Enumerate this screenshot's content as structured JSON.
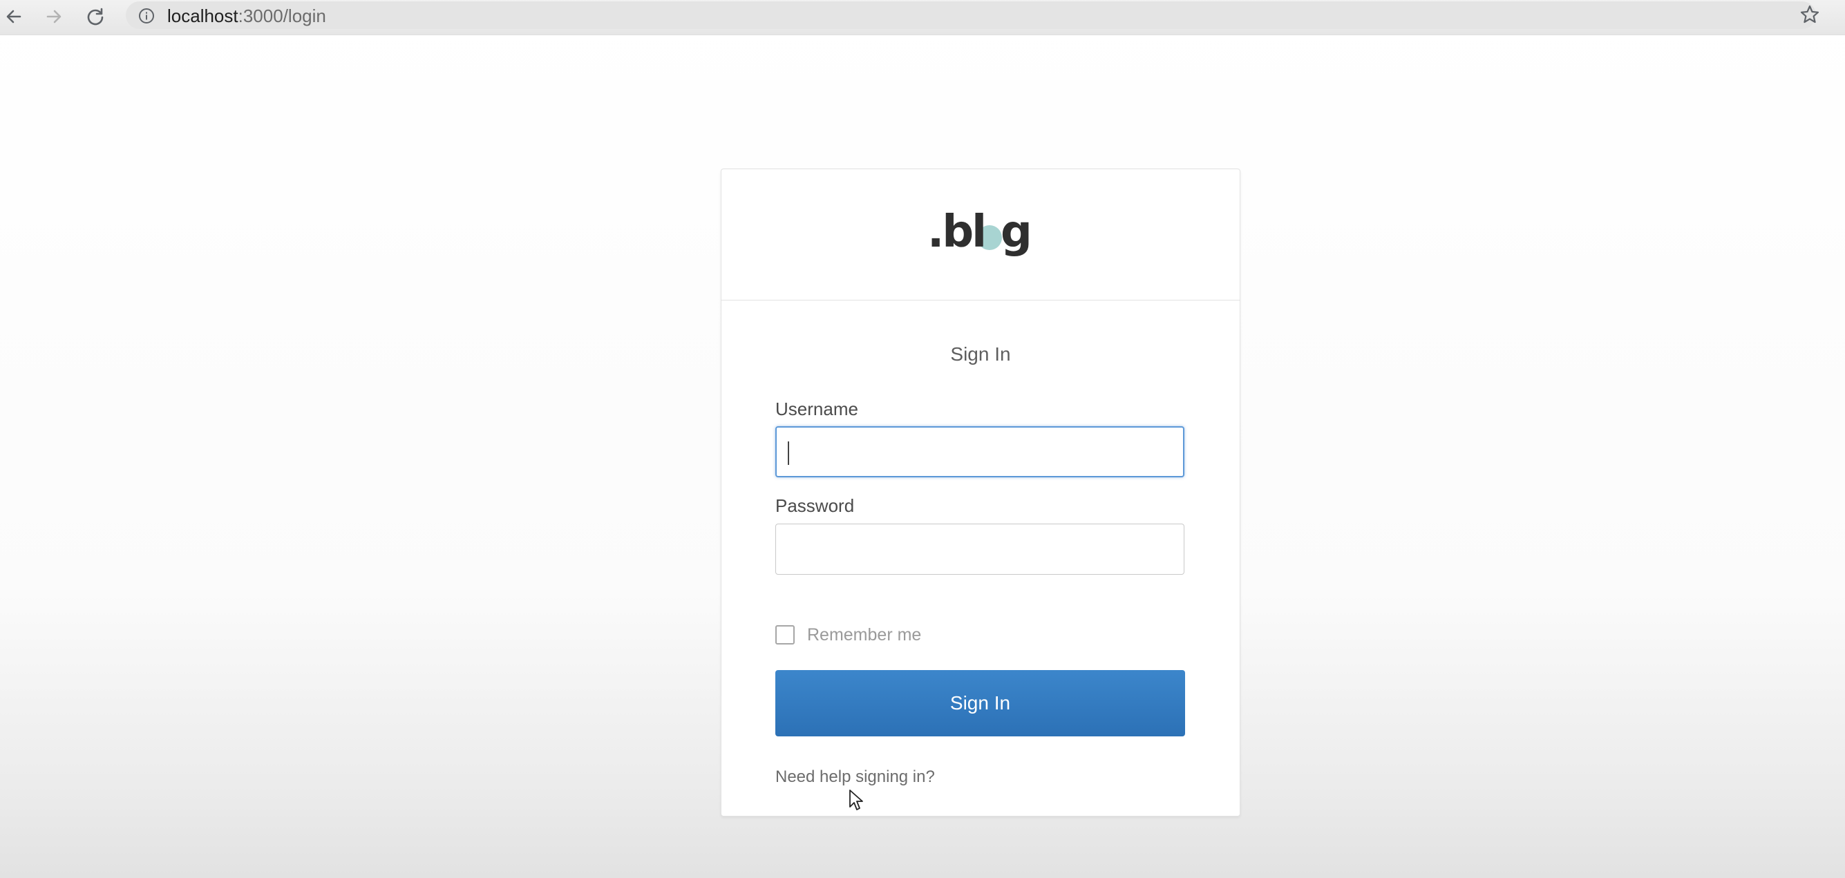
{
  "browser": {
    "url_host": "localhost",
    "url_path": ":3000/login",
    "icons": {
      "back": "arrow-left-icon",
      "forward": "arrow-right-icon",
      "reload": "reload-icon",
      "site_info": "info-icon",
      "bookmark": "star-icon"
    }
  },
  "card": {
    "logo_text": ".blog",
    "title": "Sign In",
    "username": {
      "label": "Username",
      "value": "",
      "placeholder": ""
    },
    "password": {
      "label": "Password",
      "value": "",
      "placeholder": ""
    },
    "remember_label": "Remember me",
    "remember_checked": false,
    "submit_label": "Sign In",
    "help_link": "Need help signing in?"
  },
  "colors": {
    "primary_button": "#2f77bd",
    "focus_border": "#5d99d8",
    "logo_dark": "#2f2f2f",
    "logo_accent": "#a8d4d2"
  }
}
